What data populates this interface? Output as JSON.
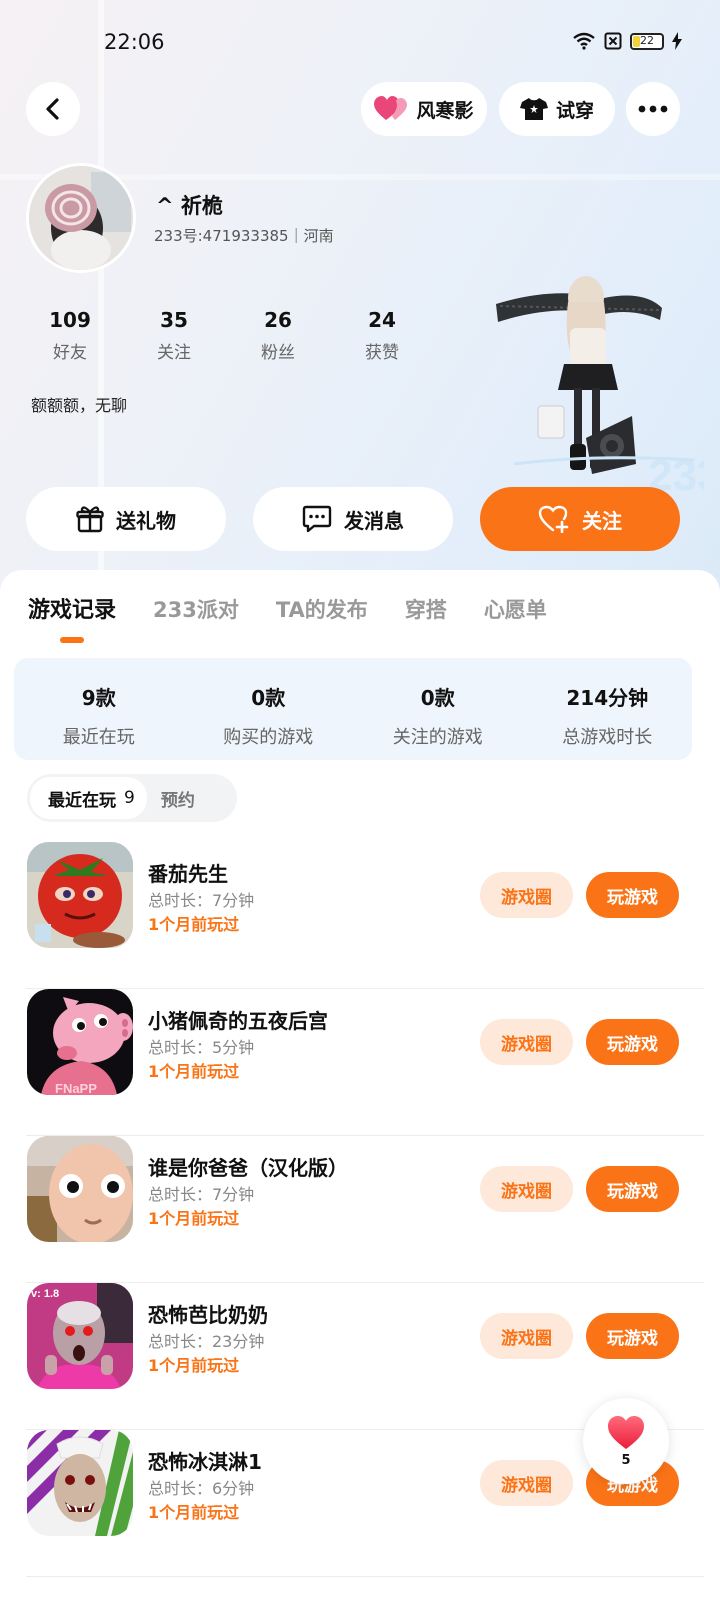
{
  "status": {
    "time": "22:06",
    "battery": "22"
  },
  "top_actions": {
    "heart_label": "风寒影",
    "tryon_label": "试穿"
  },
  "profile": {
    "username": "^ 祈桅",
    "id_line": "233号:471933385｜河南",
    "bio": "额额额，无聊",
    "stats": [
      {
        "num": "109",
        "label": "好友"
      },
      {
        "num": "35",
        "label": "关注"
      },
      {
        "num": "26",
        "label": "粉丝"
      },
      {
        "num": "24",
        "label": "获赞"
      }
    ]
  },
  "actions": {
    "gift": "送礼物",
    "message": "发消息",
    "follow": "关注"
  },
  "tabs": [
    "游戏记录",
    "233派对",
    "TA的发布",
    "穿搭",
    "心愿单"
  ],
  "summary": [
    {
      "value": "9款",
      "label": "最近在玩"
    },
    {
      "value": "0款",
      "label": "购买的游戏"
    },
    {
      "value": "0款",
      "label": "关注的游戏"
    },
    {
      "value": "214分钟",
      "label": "总游戏时长"
    }
  ],
  "sub_tabs": {
    "recent": "最近在玩",
    "recent_count": "9",
    "reserve": "预约"
  },
  "game_buttons": {
    "circle": "游戏圈",
    "play": "玩游戏"
  },
  "games": [
    {
      "name": "番茄先生",
      "duration": "总时长：7分钟",
      "last_played": "1个月前玩过"
    },
    {
      "name": "小猪佩奇的五夜后宫",
      "duration": "总时长：5分钟",
      "last_played": "1个月前玩过",
      "icon_text": "FNaPP"
    },
    {
      "name": "谁是你爸爸（汉化版）",
      "duration": "总时长：7分钟",
      "last_played": "1个月前玩过"
    },
    {
      "name": "恐怖芭比奶奶",
      "duration": "总时长：23分钟",
      "last_played": "1个月前玩过",
      "icon_text": "v: 1.8"
    },
    {
      "name": "恐怖冰淇淋1",
      "duration": "总时长：6分钟",
      "last_played": "1个月前玩过"
    }
  ],
  "like_float": {
    "count": "5"
  },
  "colors": {
    "accent": "#fa7417",
    "accent_light": "#fde8da",
    "summary_bg": "#eff5fc"
  }
}
